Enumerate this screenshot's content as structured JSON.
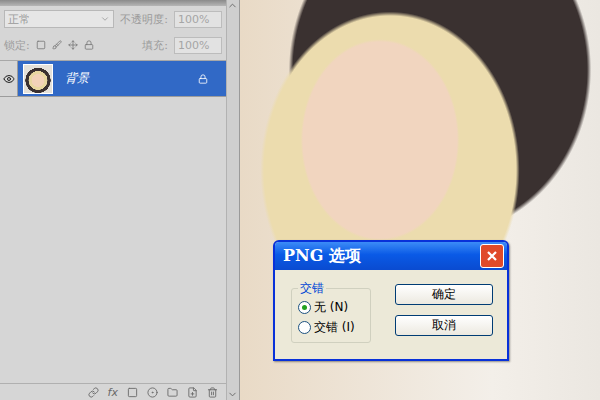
{
  "layers_panel": {
    "blend_mode": "正常",
    "opacity_label": "不透明度:",
    "opacity": "100%",
    "lock_label": "锁定:",
    "fill_label": "填充:",
    "fill": "100%",
    "layers": [
      {
        "name": "背景",
        "selected": true,
        "visible": true,
        "locked": true
      }
    ],
    "bottom_bar": {
      "fx": "fx"
    }
  },
  "dialog": {
    "title": "PNG 选项",
    "group": "交错",
    "options": [
      {
        "label": "无 (N)",
        "selected": true
      },
      {
        "label": "交错 (I)",
        "selected": false
      }
    ],
    "buttons": [
      "确定",
      "取消"
    ]
  }
}
